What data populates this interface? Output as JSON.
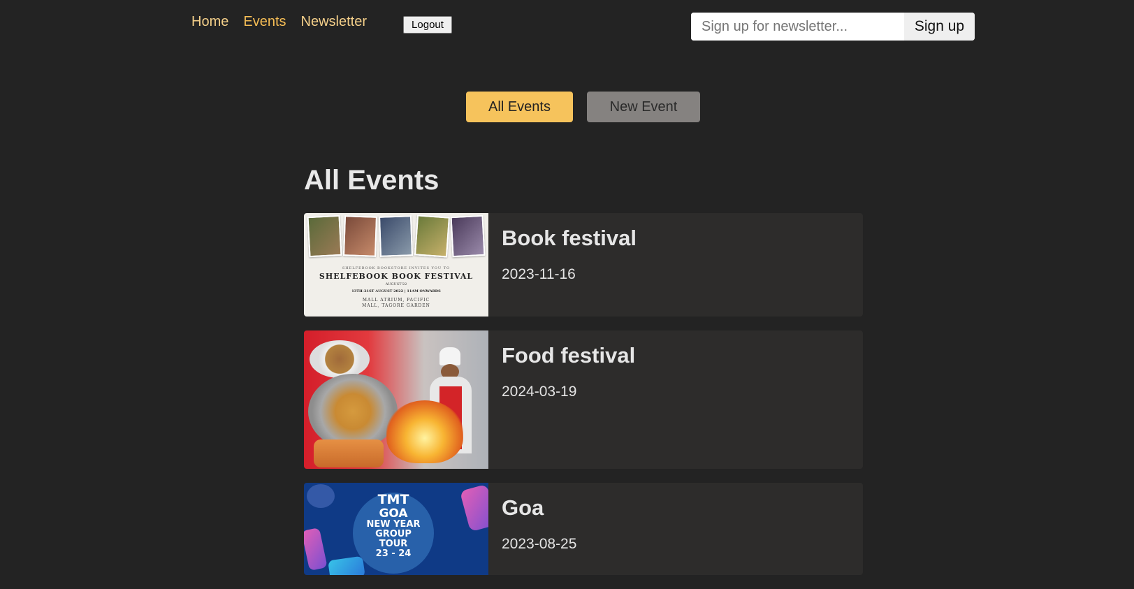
{
  "nav": {
    "items": [
      {
        "label": "Home",
        "active": false
      },
      {
        "label": "Events",
        "active": true
      },
      {
        "label": "Newsletter",
        "active": false
      }
    ],
    "logout_label": "Logout"
  },
  "newsletter": {
    "placeholder": "Sign up for newsletter...",
    "value": "",
    "button_label": "Sign up"
  },
  "tabs": {
    "all_events": "All Events",
    "new_event": "New Event"
  },
  "page_title": "All Events",
  "events": [
    {
      "title": "Book festival",
      "date": "2023-11-16",
      "image": {
        "line1": "SHELFEBOOK BOOKSTORE INVITES YOU TO",
        "line2": "SHELFEBOOK BOOK FESTIVAL",
        "line3": "AUGUST'22",
        "line4": "13TH–21ST AUGUST 2022 | 11AM ONWARDS",
        "line5a": "MALL ATRIUM, PACIFIC",
        "line5b": "MALL, TAGORE GARDEN"
      }
    },
    {
      "title": "Food festival",
      "date": "2024-03-19"
    },
    {
      "title": "Goa",
      "date": "2023-08-25",
      "image": {
        "line1": "TMT",
        "line2": "GOA",
        "line3": "NEW YEAR",
        "line4": "GROUP",
        "line5": "TOUR",
        "line6": "23 - 24"
      }
    }
  ],
  "colors": {
    "background": "#232323",
    "accent": "#f6c35c",
    "nav_link": "#f5d08a",
    "card": "#2d2c2b"
  }
}
